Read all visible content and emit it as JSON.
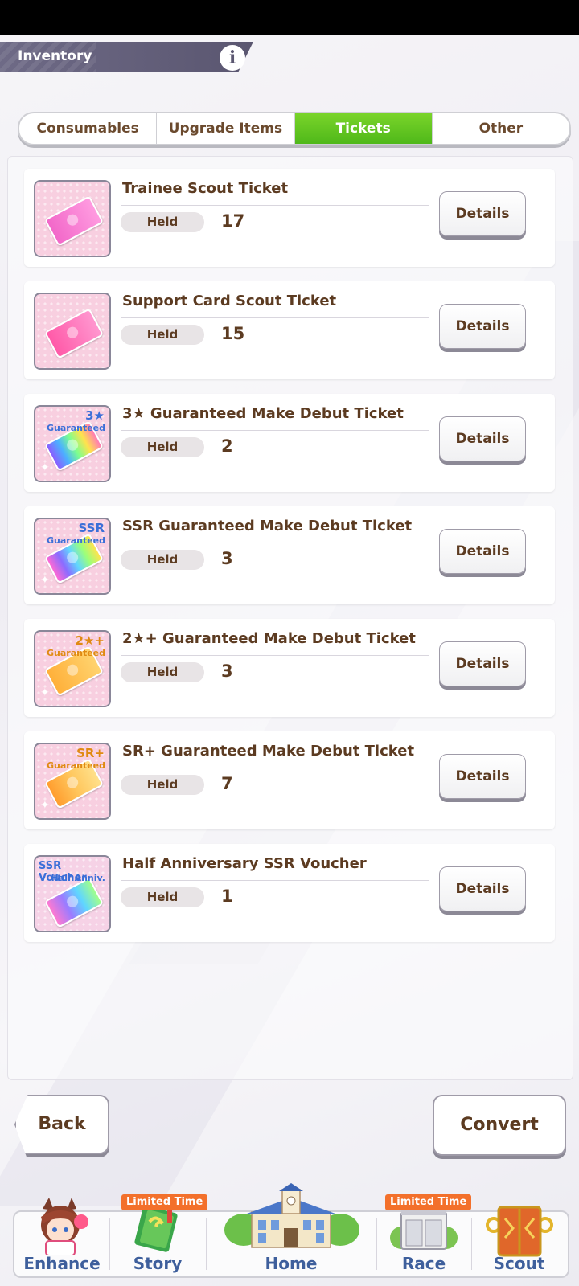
{
  "header": {
    "title": "Inventory"
  },
  "tabs": [
    {
      "label": "Consumables",
      "active": false
    },
    {
      "label": "Upgrade Items",
      "active": false
    },
    {
      "label": "Tickets",
      "active": true
    },
    {
      "label": "Other",
      "active": false
    }
  ],
  "held_label": "Held",
  "details_label": "Details",
  "items": [
    {
      "name": "Trainee Scout Ticket",
      "count": "17",
      "badge": "",
      "badge2": ""
    },
    {
      "name": "Support Card Scout Ticket",
      "count": "15",
      "badge": "",
      "badge2": ""
    },
    {
      "name": "3★ Guaranteed Make Debut Ticket",
      "count": "2",
      "badge": "3★",
      "badge2": "Guaranteed"
    },
    {
      "name": "SSR Guaranteed Make Debut Ticket",
      "count": "3",
      "badge": "SSR",
      "badge2": "Guaranteed"
    },
    {
      "name": "2★+ Guaranteed Make Debut Ticket",
      "count": "3",
      "badge": "2★+",
      "badge2": "Guaranteed"
    },
    {
      "name": "SR+ Guaranteed Make Debut Ticket",
      "count": "7",
      "badge": "SR+",
      "badge2": "Guaranteed"
    },
    {
      "name": "Half Anniversary SSR Voucher",
      "count": "1",
      "badge": "SSR Voucher",
      "badge2": "Half Anniv."
    }
  ],
  "buttons": {
    "back": "Back",
    "convert": "Convert"
  },
  "nav": {
    "limited_label": "Limited Time",
    "items": [
      {
        "label": "Enhance"
      },
      {
        "label": "Story"
      },
      {
        "label": "Home"
      },
      {
        "label": "Race"
      },
      {
        "label": "Scout"
      }
    ]
  },
  "colors": {
    "active_tab": "#5cc21f",
    "text_brown": "#5c3b21",
    "nav_label": "#3e5f9c",
    "limited_badge": "#f3702b"
  }
}
